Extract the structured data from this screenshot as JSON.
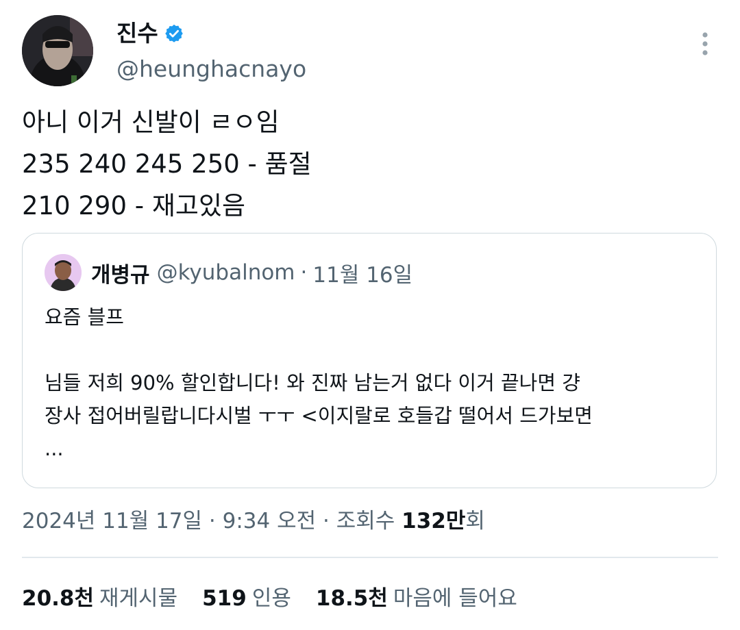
{
  "author": {
    "display_name": "진수",
    "handle": "@heunghacnayo",
    "verified": true,
    "avatar_icon": "profile-photo",
    "more_icon": "more-vertical-icon"
  },
  "tweet": {
    "lines": [
      "아니 이거 신발이 ㄹㅇ임",
      "235 240 245 250 - 품절",
      "210 290 - 재고있음"
    ]
  },
  "quoted_tweet": {
    "display_name": "개병규",
    "handle": "@kyubalnom",
    "separator": "·",
    "date": "11월 16일",
    "lines": [
      "요즘 블프",
      "",
      "님들 저희 90% 할인합니다! 와 진짜 남는거 없다 이거 끝나면 걍",
      "장사 접어버릴랍니다시벌 ㅜㅜ <이지랄로 호들갑 떨어서 드가보면",
      "..."
    ]
  },
  "meta": {
    "date": "2024년 11월 17일",
    "sep1": " · ",
    "time": "9:34 오전",
    "sep2": " · ",
    "views_label": "조회수 ",
    "views_count": "132만",
    "views_suffix": "회"
  },
  "stats": [
    {
      "count": "20.8천",
      "label": "재게시물"
    },
    {
      "count": "519",
      "label": "인용"
    },
    {
      "count": "18.5천",
      "label": "마음에 들어요"
    }
  ],
  "colors": {
    "text_primary": "#0f1419",
    "text_secondary": "#536471",
    "verified_blue": "#1d9bf0",
    "border": "#cfd9de"
  }
}
